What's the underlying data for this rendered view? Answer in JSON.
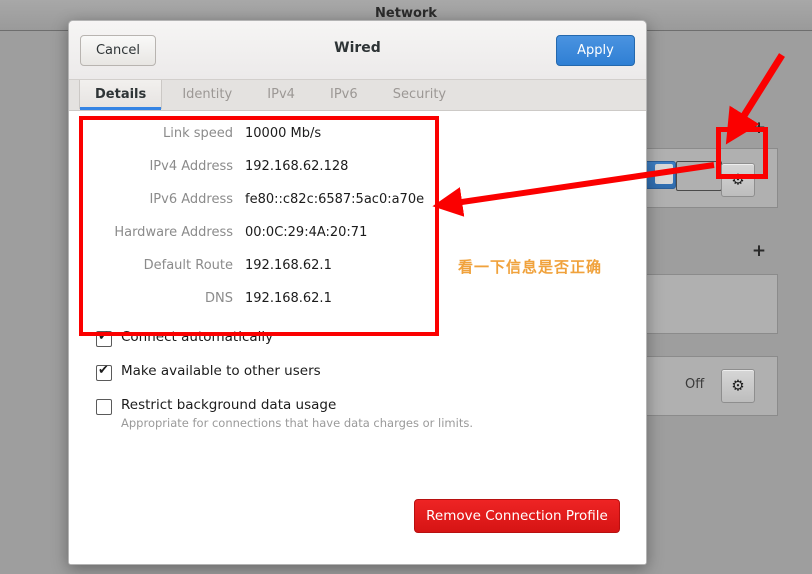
{
  "background_window": {
    "title": "Network",
    "add_icon": "plus-icon",
    "gear_icon": "gear-icon",
    "vpn_state_label": "Off"
  },
  "dialog": {
    "title": "Wired",
    "cancel_label": "Cancel",
    "apply_label": "Apply",
    "tabs": [
      {
        "label": "Details",
        "active": true
      },
      {
        "label": "Identity",
        "active": false
      },
      {
        "label": "IPv4",
        "active": false
      },
      {
        "label": "IPv6",
        "active": false
      },
      {
        "label": "Security",
        "active": false
      }
    ],
    "details": [
      {
        "label": "Link speed",
        "value": "10000 Mb/s"
      },
      {
        "label": "IPv4 Address",
        "value": "192.168.62.128"
      },
      {
        "label": "IPv6 Address",
        "value": "fe80::c82c:6587:5ac0:a70e"
      },
      {
        "label": "Hardware Address",
        "value": "00:0C:29:4A:20:71"
      },
      {
        "label": "Default Route",
        "value": "192.168.62.1"
      },
      {
        "label": "DNS",
        "value": "192.168.62.1"
      }
    ],
    "options": [
      {
        "label": "Connect automatically",
        "checked": true,
        "sub": ""
      },
      {
        "label": "Make available to other users",
        "checked": true,
        "sub": ""
      },
      {
        "label": "Restrict background data usage",
        "checked": false,
        "sub": "Appropriate for connections that have data charges or limits."
      }
    ],
    "remove_label": "Remove Connection Profile"
  },
  "annotation": {
    "text": "看一下信息是否正确",
    "color": "#fb0000",
    "text_color": "#f0a23c"
  }
}
